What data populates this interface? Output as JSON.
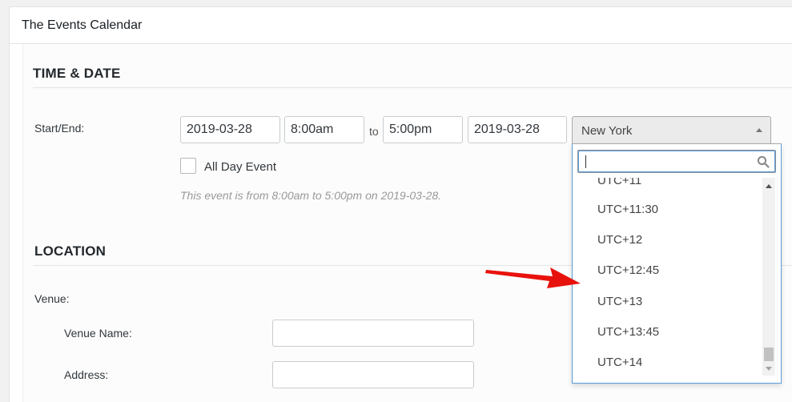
{
  "app": {
    "title": "The Events Calendar"
  },
  "time_date": {
    "section_title": "TIME & DATE",
    "start_end_label": "Start/End:",
    "start_date": "2019-03-28",
    "start_time": "8:00am",
    "to_label": "to",
    "end_time": "5:00pm",
    "end_date": "2019-03-28",
    "timezone": "New York",
    "all_day_label": "All Day Event",
    "all_day_checked": false,
    "summary": "This event is from 8:00am to 5:00pm on 2019-03-28."
  },
  "timezone_dropdown": {
    "search_value": "",
    "options": [
      "UTC+11",
      "UTC+11:30",
      "UTC+12",
      "UTC+12:45",
      "UTC+13",
      "UTC+13:45",
      "UTC+14"
    ]
  },
  "location": {
    "section_title": "LOCATION",
    "venue_label": "Venue:",
    "venue_name_label": "Venue Name:",
    "venue_name_value": "",
    "address_label": "Address:",
    "address_value": ""
  },
  "colors": {
    "focus_border": "#5b9dd9",
    "annotation_arrow": "#e8120c"
  },
  "icons": {
    "search": "search-icon",
    "select_open": "chevron-up-icon",
    "annotation": "red-arrow-icon"
  }
}
